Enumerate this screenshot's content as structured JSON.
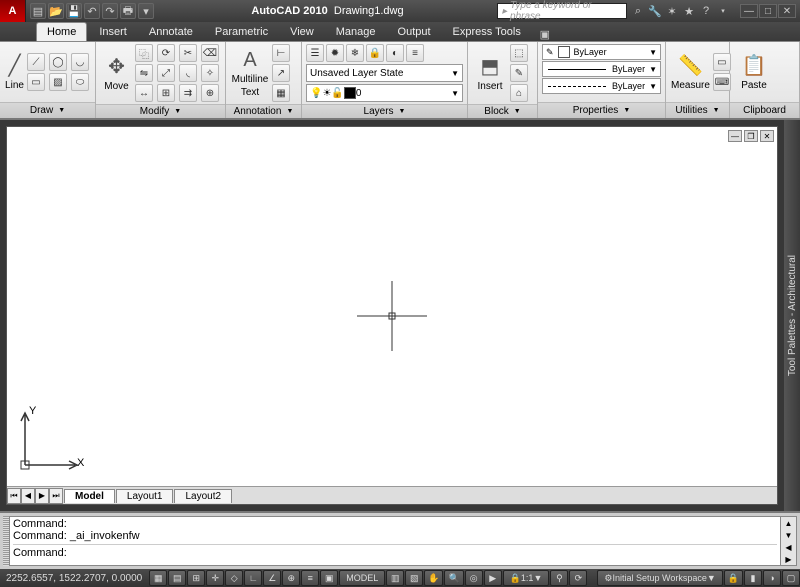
{
  "app": {
    "name": "AutoCAD 2010",
    "doc": "Drawing1.dwg"
  },
  "search": {
    "placeholder": "Type a keyword or phrase"
  },
  "tabs": [
    "Home",
    "Insert",
    "Annotate",
    "Parametric",
    "View",
    "Manage",
    "Output",
    "Express Tools"
  ],
  "active_tab": "Home",
  "ribbon": {
    "draw": {
      "title": "Draw",
      "line": "Line"
    },
    "modify": {
      "title": "Modify",
      "move": "Move"
    },
    "annotation": {
      "title": "Annotation",
      "mtext": "Multiline",
      "mtext2": "Text"
    },
    "layers": {
      "title": "Layers",
      "state": "Unsaved Layer State",
      "current": "0"
    },
    "block": {
      "title": "Block",
      "insert": "Insert"
    },
    "properties": {
      "title": "Properties",
      "bylayer": "ByLayer",
      "bylayer2": "ByLayer",
      "bylayer3": "ByLayer"
    },
    "utilities": {
      "title": "Utilities",
      "measure": "Measure"
    },
    "clipboard": {
      "title": "Clipboard",
      "paste": "Paste"
    }
  },
  "side_palette": "Tool Palettes - Architectural",
  "ucs": {
    "x": "X",
    "y": "Y"
  },
  "layout_tabs": [
    "Model",
    "Layout1",
    "Layout2"
  ],
  "command": {
    "history": [
      "Command:",
      "Command: _ai_invokenfw"
    ],
    "prompt": "Command:"
  },
  "status": {
    "coords": "2252.6557, 1522.2707, 0.0000",
    "model": "MODEL",
    "scale": "1:1",
    "workspace": "Initial Setup Workspace"
  }
}
